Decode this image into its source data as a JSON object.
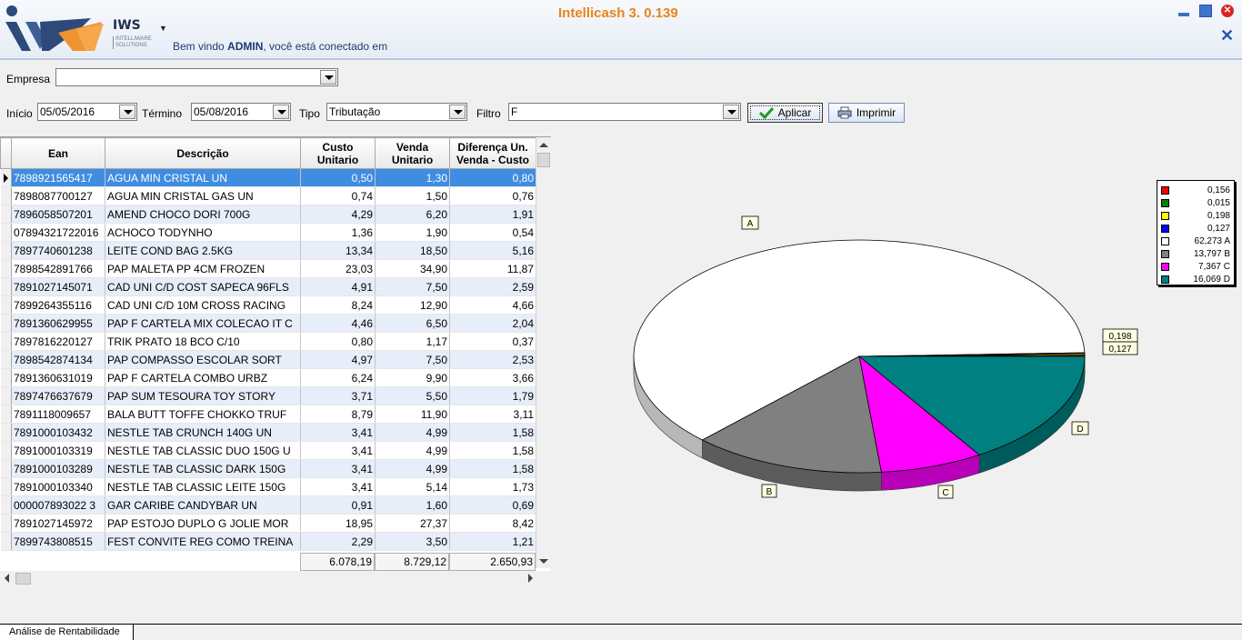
{
  "header": {
    "app_title": "Intellicash 3. 0.139",
    "brand": "IWS",
    "brand_sub": "INTELLIWARE SOLUTIONS",
    "welcome_prefix": "Bem vindo ",
    "welcome_user": "ADMIN",
    "welcome_suffix": ", você está conectado em"
  },
  "filters": {
    "empresa_label": "Empresa",
    "empresa_value": "",
    "inicio_label": "Início",
    "inicio_value": "05/05/2016",
    "termino_label": "Término",
    "termino_value": "05/08/2016",
    "tipo_label": "Tipo",
    "tipo_value": "Tributação",
    "filtro_label": "Filtro",
    "filtro_value": "F",
    "apply_label": "Aplicar",
    "print_label": "Imprimir"
  },
  "table": {
    "columns": [
      "Ean",
      "Descrição",
      "Custo Unitario",
      "Venda Unitario",
      "Diferença Un. Venda - Custo"
    ],
    "rows": [
      [
        "7898921565417",
        "AGUA MIN CRISTAL UN",
        "0,50",
        "1,30",
        "0,80"
      ],
      [
        "7898087700127",
        "AGUA MIN CRISTAL GAS UN",
        "0,74",
        "1,50",
        "0,76"
      ],
      [
        "7896058507201",
        "AMEND CHOCO DORI 700G",
        "4,29",
        "6,20",
        "1,91"
      ],
      [
        "07894321722016",
        "ACHOCO TODYNHO",
        "1,36",
        "1,90",
        "0,54"
      ],
      [
        "7897740601238",
        "LEITE COND BAG 2.5KG",
        "13,34",
        "18,50",
        "5,16"
      ],
      [
        "7898542891766",
        "PAP MALETA PP 4CM FROZEN",
        "23,03",
        "34,90",
        "11,87"
      ],
      [
        "7891027145071",
        "CAD UNI C/D COST SAPECA 96FLS",
        "4,91",
        "7,50",
        "2,59"
      ],
      [
        "7899264355116",
        "CAD UNI C/D 10M CROSS RACING",
        "8,24",
        "12,90",
        "4,66"
      ],
      [
        "7891360629955",
        "PAP F CARTELA MIX COLECAO IT C",
        "4,46",
        "6,50",
        "2,04"
      ],
      [
        "7897816220127",
        "TRIK PRATO 18 BCO C/10",
        "0,80",
        "1,17",
        "0,37"
      ],
      [
        "7898542874134",
        "PAP COMPASSO ESCOLAR SORT",
        "4,97",
        "7,50",
        "2,53"
      ],
      [
        "7891360631019",
        "PAP F CARTELA COMBO URBZ",
        "6,24",
        "9,90",
        "3,66"
      ],
      [
        "7897476637679",
        "PAP SUM TESOURA TOY STORY",
        "3,71",
        "5,50",
        "1,79"
      ],
      [
        "7891118009657",
        "BALA BUTT TOFFE CHOKKO TRUF",
        "8,79",
        "11,90",
        "3,11"
      ],
      [
        "7891000103432",
        "NESTLE TAB CRUNCH 140G UN",
        "3,41",
        "4,99",
        "1,58"
      ],
      [
        "7891000103319",
        "NESTLE TAB CLASSIC DUO 150G U",
        "3,41",
        "4,99",
        "1,58"
      ],
      [
        "7891000103289",
        "NESTLE TAB CLASSIC DARK 150G",
        "3,41",
        "4,99",
        "1,58"
      ],
      [
        "7891000103340",
        "NESTLE TAB CLASSIC LEITE 150G",
        "3,41",
        "5,14",
        "1,73"
      ],
      [
        "000007893022 3",
        "GAR CARIBE CANDYBAR UN",
        "0,91",
        "1,60",
        "0,69"
      ],
      [
        "7891027145972",
        "PAP ESTOJO DUPLO G JOLIE MOR",
        "18,95",
        "27,37",
        "8,42"
      ],
      [
        "7899743808515",
        "FEST CONVITE REG COMO TREINA",
        "2,29",
        "3,50",
        "1,21"
      ]
    ],
    "totals": {
      "custo": "6.078,19",
      "venda": "8.729,12",
      "diferenca": "2.650,93"
    }
  },
  "chart_data": {
    "type": "pie",
    "series": [
      {
        "label": "0,156",
        "value": 0.156,
        "color": "#ff0000"
      },
      {
        "label": "0,015",
        "value": 0.015,
        "color": "#008000"
      },
      {
        "label": "0,198",
        "value": 0.198,
        "color": "#ffff00"
      },
      {
        "label": "0,127",
        "value": 0.127,
        "color": "#0000ff"
      },
      {
        "label": "62,273 A",
        "value": 62.273,
        "color": "#ffffff"
      },
      {
        "label": "13,797 B",
        "value": 13.797,
        "color": "#808080"
      },
      {
        "label": "7,367 C",
        "value": 7.367,
        "color": "#ff00ff"
      },
      {
        "label": "16,069 D",
        "value": 16.069,
        "color": "#008080"
      }
    ],
    "callouts": [
      "A",
      "B",
      "C",
      "D",
      "0,198",
      "0,127"
    ],
    "legend_position": "top-right"
  },
  "tabs": [
    {
      "label": "Análise de Rentabilidade"
    }
  ]
}
